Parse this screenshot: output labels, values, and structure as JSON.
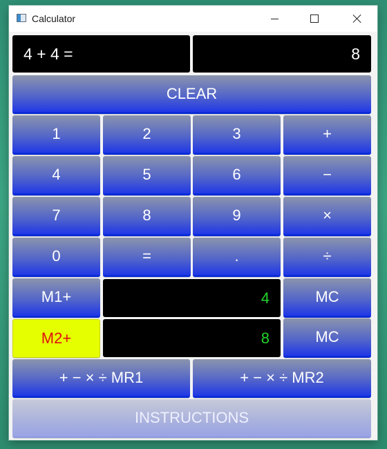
{
  "window": {
    "title": "Calculator",
    "controls": {
      "minimize": "minimize",
      "maximize": "maximize",
      "close": "close"
    }
  },
  "display": {
    "expression": "4 + 4 =",
    "result": "8"
  },
  "buttons": {
    "clear": "CLEAR",
    "keypad": [
      "1",
      "2",
      "3",
      "+",
      "4",
      "5",
      "6",
      "−",
      "7",
      "8",
      "9",
      "×",
      "0",
      "=",
      ".",
      "÷"
    ],
    "m1_add": "M1+",
    "m1_clear": "MC",
    "m2_add": "M2+",
    "m2_clear": "MC",
    "mr1": "+ − × ÷ MR1",
    "mr2": "+ − × ÷ MR2",
    "instructions": "INSTRUCTIONS"
  },
  "memory": {
    "m1": "4",
    "m2": "8"
  },
  "colors": {
    "button_gradient_top": "#8b94ad",
    "button_gradient_bottom": "#2038e6",
    "m2_highlight": "#e6ff00",
    "m2_text": "#e01010",
    "memory_text": "#22d62a"
  }
}
